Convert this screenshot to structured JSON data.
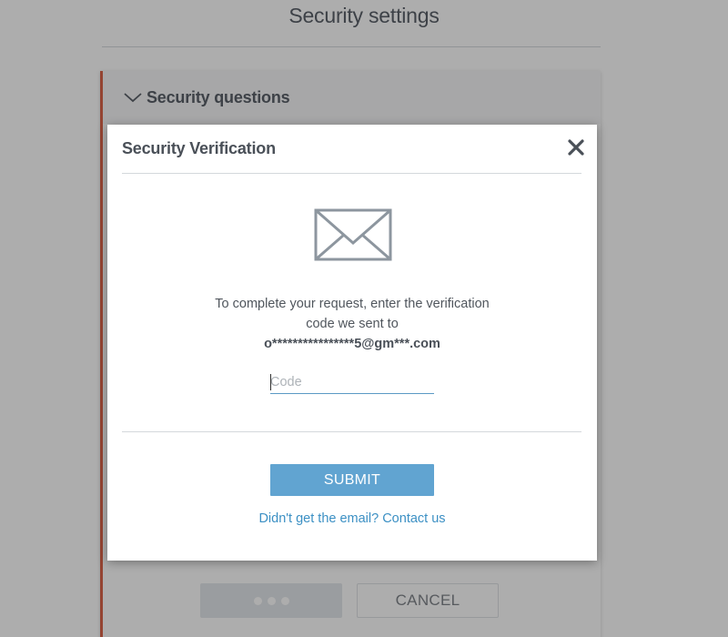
{
  "page": {
    "title": "Security settings"
  },
  "section": {
    "header_label": "Security questions",
    "expanded_icon": "chevron-down-icon"
  },
  "background_buttons": {
    "save_label": "",
    "save_state": "loading",
    "cancel_label": "CANCEL"
  },
  "modal": {
    "title": "Security Verification",
    "close_icon": "close-icon",
    "illustration_icon": "envelope-icon",
    "instruction_line1": "To complete your request, enter the verification",
    "instruction_line2": "code we sent to",
    "masked_email": "o****************5@gm***.com",
    "code_input": {
      "value": "",
      "placeholder": "Code"
    },
    "submit_label": "SUBMIT",
    "contact_link": "Didn't get the email? Contact us"
  },
  "colors": {
    "accent_border": "#d54a2b",
    "primary_button": "#61a4d1",
    "link": "#3c90c4",
    "input_underline": "#5b9ac4"
  }
}
